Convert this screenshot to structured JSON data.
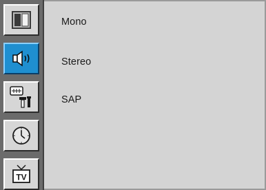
{
  "menu": {
    "categories": [
      {
        "icon": "picture-icon",
        "active": false
      },
      {
        "icon": "speaker-icon",
        "active": true
      },
      {
        "icon": "setup-tools-icon",
        "active": false
      },
      {
        "icon": "clock-icon",
        "active": false
      },
      {
        "icon": "tv-icon",
        "active": false
      }
    ],
    "options": [
      {
        "label": "Mono"
      },
      {
        "label": "Stereo"
      },
      {
        "label": "SAP"
      }
    ]
  },
  "colors": {
    "active_tile": "#1f8fd0",
    "tile": "#d6d6d6",
    "panel": "#d4d4d4",
    "sidebar": "#6b6b6b"
  }
}
